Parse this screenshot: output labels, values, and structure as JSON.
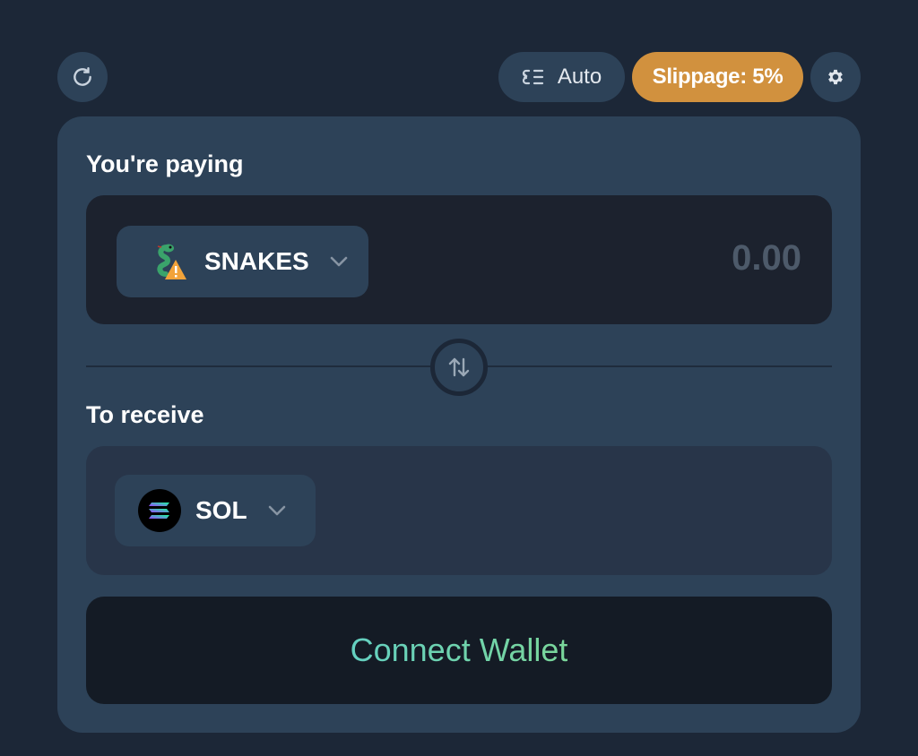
{
  "toolbar": {
    "refresh_icon": "refresh-icon",
    "auto_label": "Auto",
    "auto_icon": "routing-list-icon",
    "slippage_label": "Slippage: 5%",
    "settings_icon": "gear-icon"
  },
  "swap": {
    "paying_label": "You're paying",
    "pay_token": {
      "symbol": "SNAKES",
      "icon": "snake-warning-icon"
    },
    "pay_amount_placeholder": "0.00",
    "switch_icon": "swap-arrows-icon",
    "receive_label": "To receive",
    "receive_token": {
      "symbol": "SOL",
      "icon": "solana-icon"
    },
    "connect_label": "Connect Wallet"
  },
  "colors": {
    "background": "#1c2737",
    "card": "#2d4258",
    "slippage": "#d1913e",
    "connect_gradient_start": "#64d0c1",
    "connect_gradient_end": "#7ad69a"
  }
}
